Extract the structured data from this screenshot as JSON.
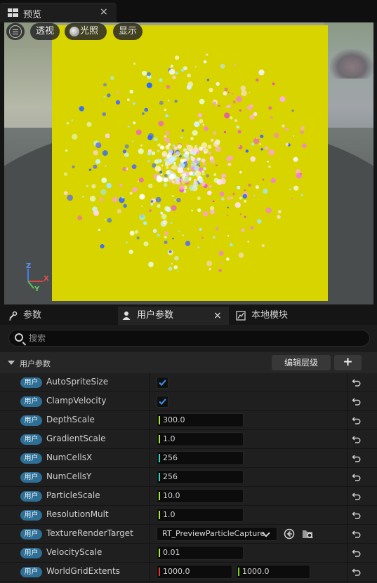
{
  "window": {
    "tab_title": "预览",
    "close_glyph": "×"
  },
  "viewport": {
    "buttons": {
      "perspective": "透视",
      "lighting": "光照",
      "show": "显示"
    },
    "axes": {
      "x": "X",
      "y": "Y",
      "z": "Z"
    },
    "card_color": "#d8d400"
  },
  "panel": {
    "tabs": [
      {
        "label": "参数",
        "icon": "wrench-icon"
      },
      {
        "label": "用户参数",
        "icon": "user-icon"
      },
      {
        "label": "本地模块",
        "icon": "graph-icon"
      }
    ],
    "search_placeholder": "搜索",
    "section": {
      "title": "用户参数",
      "edit_button": "编辑层级",
      "add_button": "+"
    },
    "badge_text": "用户",
    "params": [
      {
        "name": "AutoSpriteSize",
        "type": "bool",
        "value": true
      },
      {
        "name": "ClampVelocity",
        "type": "bool",
        "value": true
      },
      {
        "name": "DepthScale",
        "type": "float",
        "value": "300.0"
      },
      {
        "name": "GradientScale",
        "type": "float",
        "value": "1.0"
      },
      {
        "name": "NumCellsX",
        "type": "int",
        "value": "256"
      },
      {
        "name": "NumCellsY",
        "type": "int",
        "value": "256"
      },
      {
        "name": "ParticleScale",
        "type": "float",
        "value": "10.0"
      },
      {
        "name": "ResolutionMult",
        "type": "float",
        "value": "1.0"
      },
      {
        "name": "TextureRenderTarget",
        "type": "asset",
        "value": "RT_PreviewParticleCapture"
      },
      {
        "name": "VelocityScale",
        "type": "float",
        "value": "0.01"
      },
      {
        "name": "WorldGridExtents",
        "type": "vec2",
        "value_x": "1000.0",
        "value_y": "1000.0"
      }
    ]
  },
  "colors": {
    "badge": "#2e6f96",
    "float_bar": "#a3e635",
    "int_bar": "#2dd4bf",
    "vec_x_bar": "#e53935",
    "vec_y_bar": "#7ed321",
    "checkbox": "#3d8ee8"
  }
}
